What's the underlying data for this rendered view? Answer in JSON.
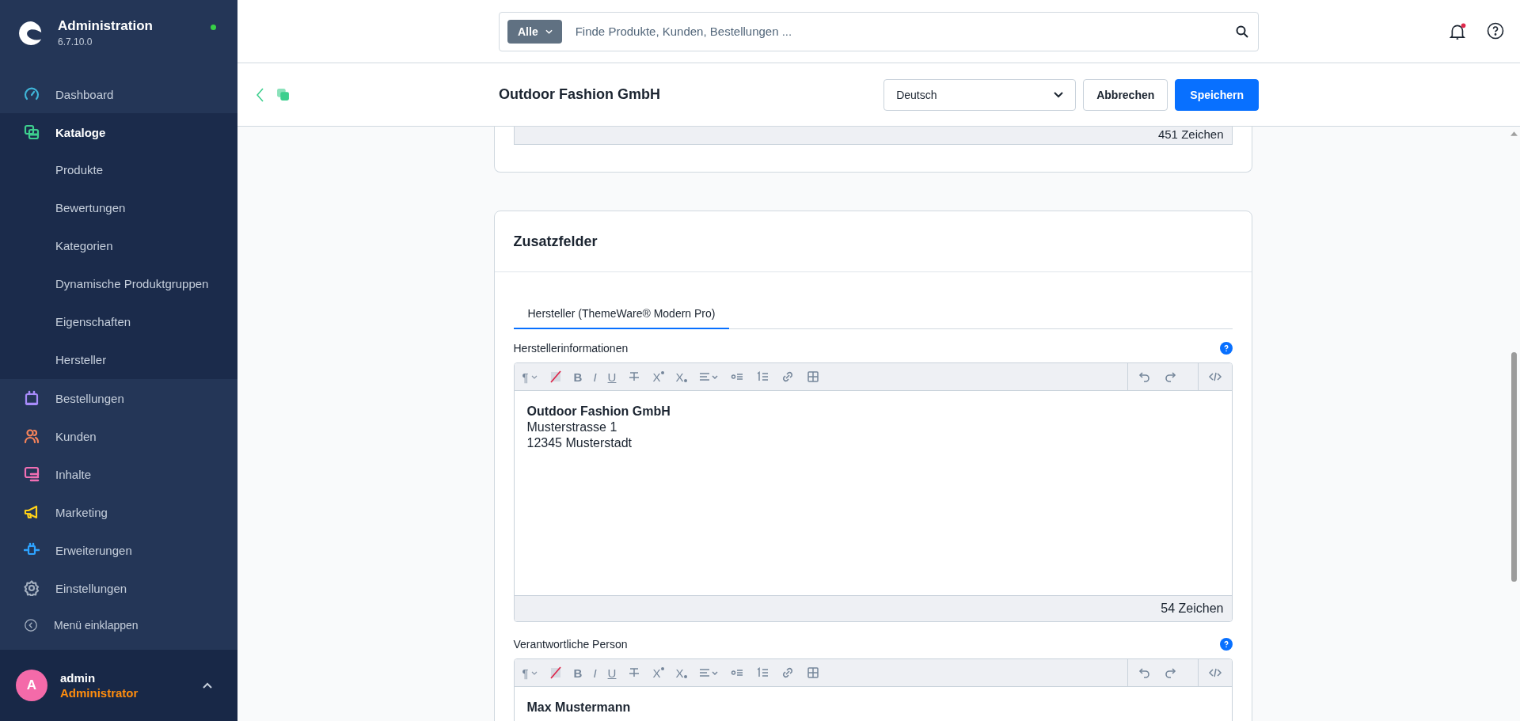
{
  "sidebar": {
    "title": "Administration",
    "version": "6.7.10.0",
    "online": true,
    "items": [
      {
        "label": "Dashboard",
        "kind": "gauge",
        "color": "#3fb5d8",
        "selected": false,
        "expanded": false
      },
      {
        "label": "Kataloge",
        "kind": "copy",
        "color": "#3dcf8e",
        "selected": true,
        "expanded": true,
        "children": [
          {
            "label": "Produkte"
          },
          {
            "label": "Bewertungen"
          },
          {
            "label": "Kategorien"
          },
          {
            "label": "Dynamische Produktgruppen"
          },
          {
            "label": "Eigenschaften"
          },
          {
            "label": "Hersteller"
          }
        ]
      },
      {
        "label": "Bestellungen",
        "kind": "bag",
        "color": "#a78bfa",
        "selected": false,
        "expanded": false
      },
      {
        "label": "Kunden",
        "kind": "people",
        "color": "#f8845a",
        "selected": false,
        "expanded": false
      },
      {
        "label": "Inhalte",
        "kind": "content",
        "color": "#f16fb4",
        "selected": false,
        "expanded": false
      },
      {
        "label": "Marketing",
        "kind": "megaphone",
        "color": "#ffd117",
        "selected": false,
        "expanded": false
      },
      {
        "label": "Erweiterungen",
        "kind": "plug",
        "color": "#2ea3ff",
        "selected": false,
        "expanded": false
      },
      {
        "label": "Einstellungen",
        "kind": "gear",
        "color": "#a3afbf",
        "selected": false,
        "expanded": false
      }
    ],
    "collapse": "Menü einklappen",
    "user": {
      "initial": "A",
      "name": "admin",
      "role": "Administrator"
    }
  },
  "search": {
    "scope": "Alle",
    "placeholder": "Finde Produkte, Kunden, Bestellungen ..."
  },
  "notifications": {
    "unread": true
  },
  "subheader": {
    "title": "Outdoor Fashion GmbH",
    "language": "Deutsch",
    "cancel": "Abbrechen",
    "save": "Speichern"
  },
  "previous_field": {
    "counter": "451 Zeichen"
  },
  "card": {
    "title": "Zusatzfelder",
    "tabs": [
      {
        "label": "Hersteller (ThemeWare® Modern Pro)",
        "selected": true
      }
    ],
    "fields": [
      {
        "label": "Herstellerinformationen",
        "counter": "54 Zeichen",
        "toolbar": [
          {
            "kind": "paragraph",
            "label": "¶"
          },
          {
            "kind": "clear"
          },
          {
            "kind": "bold",
            "label": "B"
          },
          {
            "kind": "italic",
            "label": "I"
          },
          {
            "kind": "underline",
            "label": "U"
          },
          {
            "kind": "strike"
          },
          {
            "kind": "superscript",
            "label": "X"
          },
          {
            "kind": "subscript",
            "label": "X"
          },
          {
            "kind": "align"
          },
          {
            "kind": "bullets"
          },
          {
            "kind": "numbers"
          },
          {
            "kind": "link"
          },
          {
            "kind": "table"
          }
        ],
        "lines": [
          {
            "text": "Outdoor Fashion GmbH",
            "bold": true
          },
          {
            "text": "Musterstrasse 1",
            "bold": false
          },
          {
            "text": "12345 Musterstadt",
            "bold": false
          }
        ]
      },
      {
        "label": "Verantwortliche Person",
        "toolbar": [
          {
            "kind": "paragraph",
            "label": "¶"
          },
          {
            "kind": "clear"
          },
          {
            "kind": "bold",
            "label": "B"
          },
          {
            "kind": "italic",
            "label": "I"
          },
          {
            "kind": "underline",
            "label": "U"
          },
          {
            "kind": "strike"
          },
          {
            "kind": "superscript",
            "label": "X"
          },
          {
            "kind": "subscript",
            "label": "X"
          },
          {
            "kind": "align"
          },
          {
            "kind": "bullets"
          },
          {
            "kind": "numbers"
          },
          {
            "kind": "link"
          },
          {
            "kind": "table"
          }
        ],
        "lines": [
          {
            "text": "Max Mustermann",
            "bold": true
          }
        ]
      }
    ]
  }
}
